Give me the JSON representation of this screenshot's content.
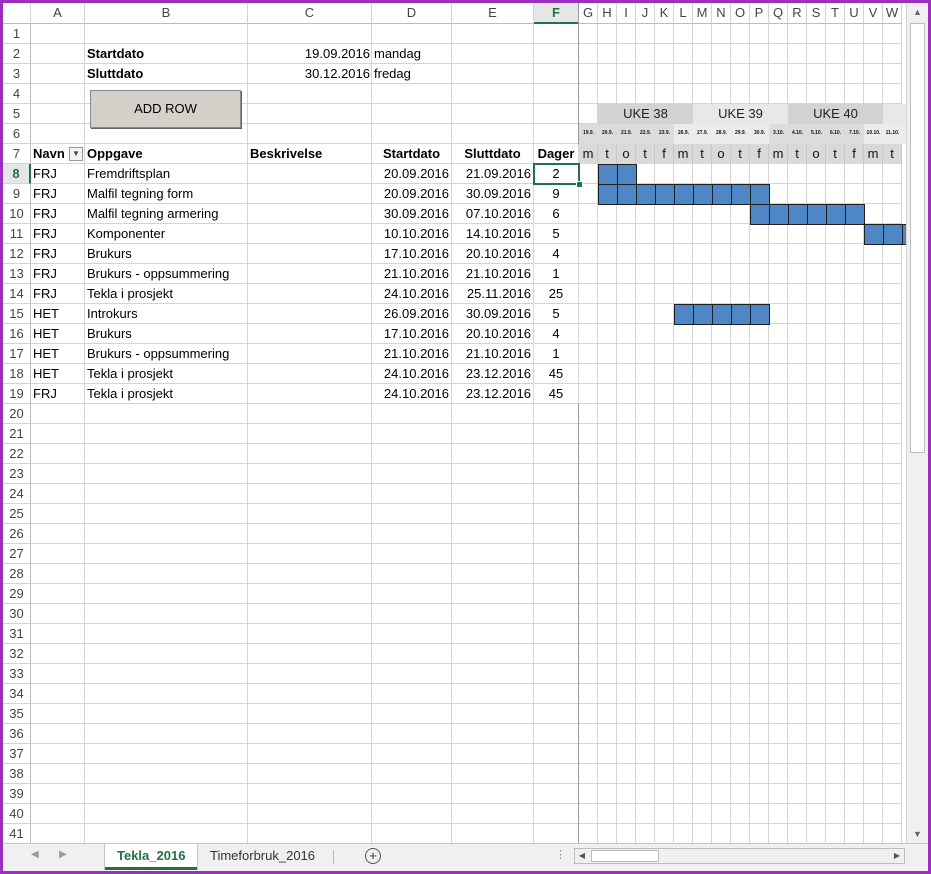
{
  "columns": [
    "A",
    "B",
    "C",
    "D",
    "E",
    "F",
    "G",
    "H",
    "I",
    "J",
    "K",
    "L",
    "M",
    "N",
    "O",
    "P",
    "Q",
    "R",
    "S",
    "T",
    "U",
    "V",
    "W"
  ],
  "rows": [
    "1",
    "2",
    "3",
    "4",
    "5",
    "6",
    "7",
    "8",
    "9",
    "10",
    "11",
    "12",
    "13",
    "14",
    "15",
    "16",
    "17",
    "18",
    "19",
    "20",
    "21",
    "22",
    "23",
    "24",
    "25",
    "26",
    "27",
    "28",
    "29",
    "30",
    "31",
    "32",
    "33",
    "34",
    "35",
    "36",
    "37",
    "38",
    "39",
    "40",
    "41"
  ],
  "header": {
    "start_label": "Startdato",
    "start_value": "19.09.2016",
    "start_day": "mandag",
    "end_label": "Sluttdato",
    "end_value": "30.12.2016",
    "end_day": "fredag"
  },
  "button": {
    "label": "ADD ROW"
  },
  "table": {
    "headers": [
      "Navn",
      "Oppgave",
      "Beskrivelse",
      "Startdato",
      "Sluttdato",
      "Dager"
    ],
    "rows": [
      [
        "FRJ",
        "Fremdriftsplan",
        "",
        "20.09.2016",
        "21.09.2016",
        "2"
      ],
      [
        "FRJ",
        "Malfil tegning form",
        "",
        "20.09.2016",
        "30.09.2016",
        "9"
      ],
      [
        "FRJ",
        "Malfil tegning armering",
        "",
        "30.09.2016",
        "07.10.2016",
        "6"
      ],
      [
        "FRJ",
        "Komponenter",
        "",
        "10.10.2016",
        "14.10.2016",
        "5"
      ],
      [
        "FRJ",
        "Brukurs",
        "",
        "17.10.2016",
        "20.10.2016",
        "4"
      ],
      [
        "FRJ",
        "Brukurs - oppsummering",
        "",
        "21.10.2016",
        "21.10.2016",
        "1"
      ],
      [
        "FRJ",
        "Tekla i prosjekt",
        "",
        "24.10.2016",
        "25.11.2016",
        "25"
      ],
      [
        "HET",
        "Introkurs",
        "",
        "26.09.2016",
        "30.09.2016",
        "5"
      ],
      [
        "HET",
        "Brukurs",
        "",
        "17.10.2016",
        "20.10.2016",
        "4"
      ],
      [
        "HET",
        "Brukurs - oppsummering",
        "",
        "21.10.2016",
        "21.10.2016",
        "1"
      ],
      [
        "HET",
        "Tekla i prosjekt",
        "",
        "24.10.2016",
        "23.12.2016",
        "45"
      ],
      [
        "FRJ",
        "Tekla i prosjekt",
        "",
        "24.10.2016",
        "23.12.2016",
        "45"
      ]
    ]
  },
  "gantt": {
    "weeks": [
      "UKE 38",
      "UKE 39",
      "UKE 40",
      "UK"
    ],
    "dates": [
      "19.9.",
      "20.9.",
      "21.9.",
      "22.9.",
      "23.9.",
      "26.9.",
      "27.9.",
      "28.9.",
      "29.9.",
      "30.9.",
      "3.10.",
      "4.10.",
      "5.10.",
      "6.10.",
      "7.10.",
      "10.10.",
      "11.10.",
      "1"
    ],
    "days": [
      "m",
      "t",
      "o",
      "t",
      "f",
      "m",
      "t",
      "o",
      "t",
      "f",
      "m",
      "t",
      "o",
      "t",
      "f",
      "m",
      "t"
    ]
  },
  "tabs": {
    "sheet1": "Tekla_2016",
    "sheet2": "Timeforbruk_2016"
  },
  "colors": {
    "bar": "#4f86c6",
    "accent": "#217346",
    "frame": "#9b2fbf"
  }
}
